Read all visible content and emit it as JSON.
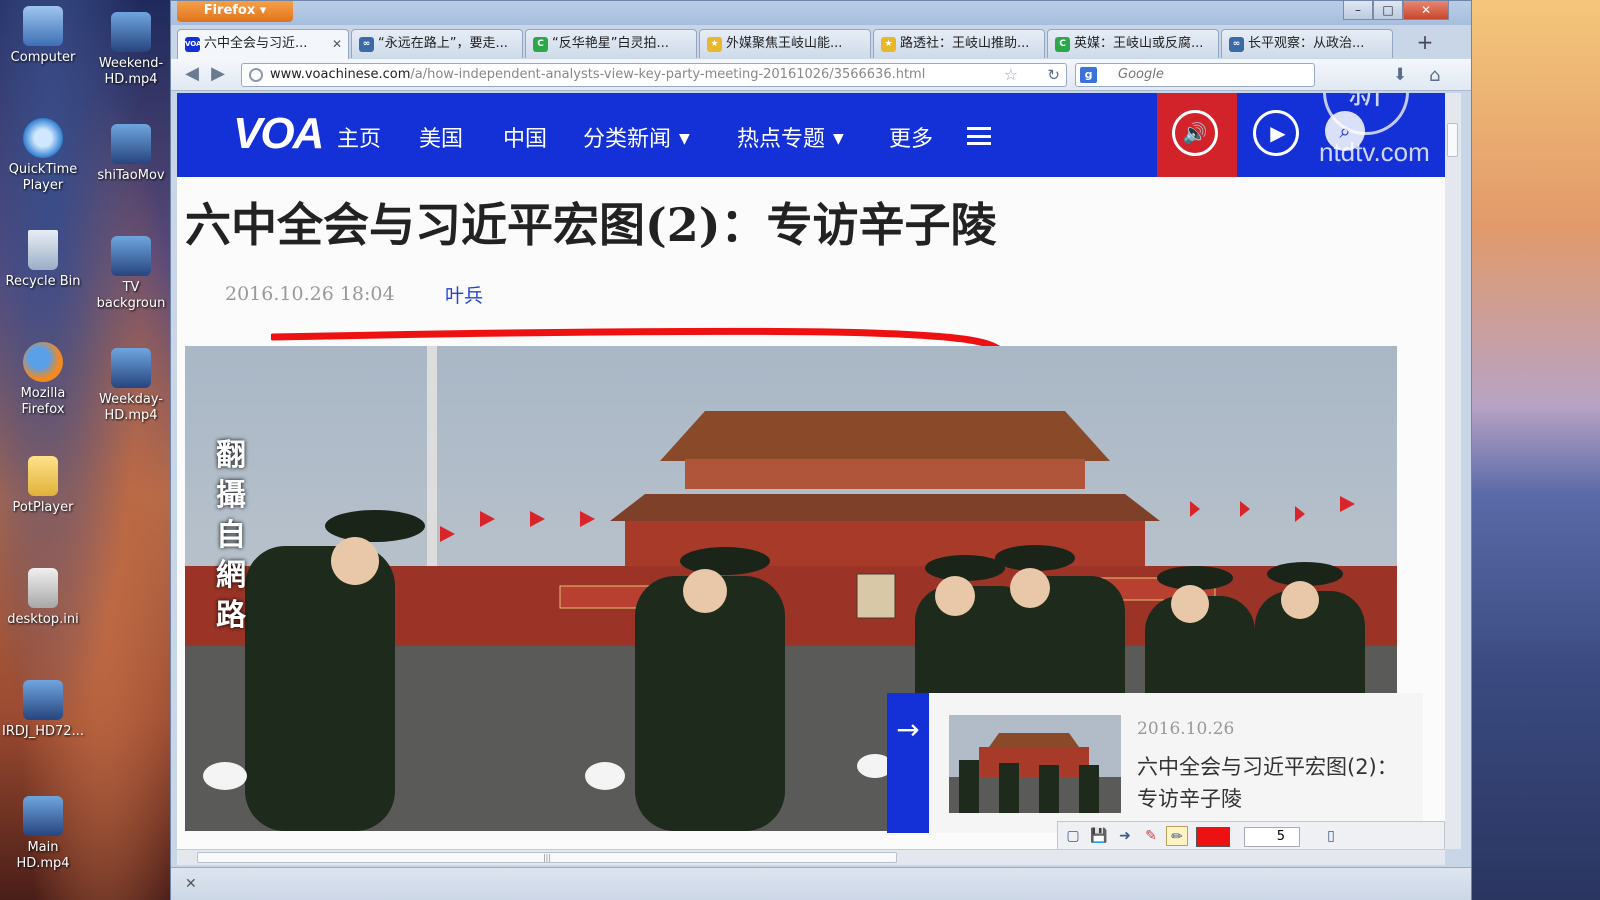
{
  "desktop": {
    "icons": [
      {
        "label": "Computer"
      },
      {
        "label": "Weekend-HD.mp4"
      },
      {
        "label": "QuickTime Player"
      },
      {
        "label": "shiTaoMov"
      },
      {
        "label": "Recycle Bin"
      },
      {
        "label": "TV backgroun"
      },
      {
        "label": "Mozilla Firefox"
      },
      {
        "label": "Weekday-HD.mp4"
      },
      {
        "label": "PotPlayer"
      },
      {
        "label": "desktop.ini"
      },
      {
        "label": "IRDJ_HD72..."
      },
      {
        "label": "Main HD.mp4"
      }
    ]
  },
  "browser": {
    "app_button": "Firefox ▾",
    "tabs": [
      {
        "label": "六中全会与习近...",
        "fav": "VOA"
      },
      {
        "label": "“永远在路上”，要走...",
        "fav": "∞"
      },
      {
        "label": "“反华艳星”白灵拍...",
        "fav": "C"
      },
      {
        "label": "外媒聚焦王岐山能...",
        "fav": "★"
      },
      {
        "label": "路透社：王岐山推助...",
        "fav": "★"
      },
      {
        "label": "英媒：王岐山或反腐...",
        "fav": "C"
      },
      {
        "label": "长平观察：从政治...",
        "fav": "∞"
      }
    ],
    "url_domain": "www.voachinese.com",
    "url_path": "/a/how-independent-analysts-view-key-party-meeting-20161026/3566636.html",
    "search_placeholder": "Google",
    "search_engine": "g"
  },
  "voa": {
    "logo": "VOA",
    "nav": [
      "主页",
      "美国",
      "中国",
      "分类新闻",
      "热点专题",
      "更多"
    ],
    "brand_color": "#1331d6",
    "audio_color": "#d2232a"
  },
  "watermark": {
    "text": "ntdtv.com"
  },
  "article": {
    "headline": "六中全会与习近平宏图(2)：专访辛子陵",
    "date": "2016.10.26 18:04",
    "author": "叶兵",
    "photo_caption": "翻\n攝\n自\n網\n路"
  },
  "related": {
    "date": "2016.10.26",
    "title": "六中全会与习近平宏图(2)：专访辛子陵"
  },
  "annotation_tool": {
    "pen_color": "#ee1111",
    "pen_size": "5"
  }
}
